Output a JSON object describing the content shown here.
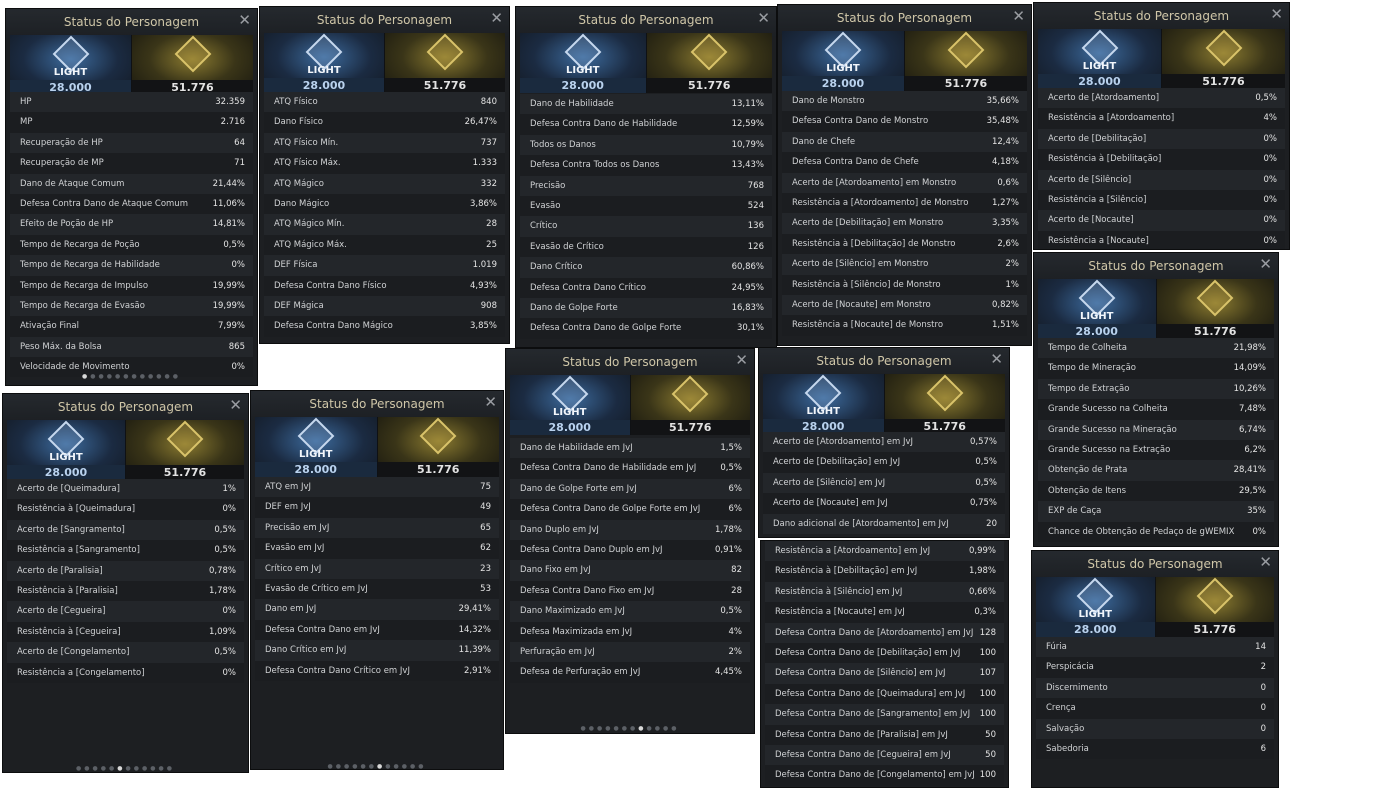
{
  "shared": {
    "panel_title": "Status do Personagem",
    "light_label": "LIGHT",
    "light_value": "28.000",
    "dark_value": "51.776"
  },
  "panels": [
    {
      "rows": [
        [
          "HP",
          "32.359"
        ],
        [
          "MP",
          "2.716"
        ],
        [
          "Recuperação de HP",
          "64"
        ],
        [
          "Recuperação de MP",
          "71"
        ],
        [
          "Dano de Ataque Comum",
          "21,44%"
        ],
        [
          "Defesa Contra Dano de Ataque Comum",
          "11,06%"
        ],
        [
          "Efeito de Poção de HP",
          "14,81%"
        ],
        [
          "Tempo de Recarga de Poção",
          "0,5%"
        ],
        [
          "Tempo de Recarga de Habilidade",
          "0%"
        ],
        [
          "Tempo de Recarga de Impulso",
          "19,99%"
        ],
        [
          "Tempo de Recarga de Evasão",
          "19,99%"
        ],
        [
          "Ativação Final",
          "7,99%"
        ],
        [
          "Peso Máx. da Bolsa",
          "865"
        ],
        [
          "Velocidade de Movimento",
          "0%"
        ]
      ]
    },
    {
      "rows": [
        [
          "ATQ Físico",
          "840"
        ],
        [
          "Dano Físico",
          "26,47%"
        ],
        [
          "ATQ Físico Mín.",
          "737"
        ],
        [
          "ATQ Físico Máx.",
          "1.333"
        ],
        [
          "ATQ Mágico",
          "332"
        ],
        [
          "Dano Mágico",
          "3,86%"
        ],
        [
          "ATQ Mágico Mín.",
          "28"
        ],
        [
          "ATQ Mágico Máx.",
          "25"
        ],
        [
          "DEF Física",
          "1.019"
        ],
        [
          "Defesa Contra Dano Físico",
          "4,93%"
        ],
        [
          "DEF Mágica",
          "908"
        ],
        [
          "Defesa Contra Dano Mágico",
          "3,85%"
        ]
      ]
    },
    {
      "rows": [
        [
          "Dano de Habilidade",
          "13,11%"
        ],
        [
          "Defesa Contra Dano de Habilidade",
          "12,59%"
        ],
        [
          "Todos os Danos",
          "10,79%"
        ],
        [
          "Defesa Contra Todos os Danos",
          "13,43%"
        ],
        [
          "Precisão",
          "768"
        ],
        [
          "Evasão",
          "524"
        ],
        [
          "Crítico",
          "136"
        ],
        [
          "Evasão de Crítico",
          "126"
        ],
        [
          "Dano Crítico",
          "60,86%"
        ],
        [
          "Defesa Contra Dano Crítico",
          "24,95%"
        ],
        [
          "Dano de Golpe Forte",
          "16,83%"
        ],
        [
          "Defesa Contra Dano de Golpe Forte",
          "30,1%"
        ]
      ]
    },
    {
      "rows": [
        [
          "Dano de Monstro",
          "35,66%"
        ],
        [
          "Defesa Contra Dano de Monstro",
          "35,48%"
        ],
        [
          "Dano de Chefe",
          "12,4%"
        ],
        [
          "Defesa Contra Dano de Chefe",
          "4,18%"
        ],
        [
          "Acerto de [Atordoamento] em Monstro",
          "0,6%"
        ],
        [
          "Resistência a [Atordoamento] de Monstro",
          "1,27%"
        ],
        [
          "Acerto de [Debilitação] em Monstro",
          "3,35%"
        ],
        [
          "Resistência à [Debilitação] de Monstro",
          "2,6%"
        ],
        [
          "Acerto de [Silêncio] em Monstro",
          "2%"
        ],
        [
          "Resistência à [Silêncio] de Monstro",
          "1%"
        ],
        [
          "Acerto de [Nocaute] em Monstro",
          "0,82%"
        ],
        [
          "Resistência a [Nocaute] de Monstro",
          "1,51%"
        ]
      ]
    },
    {
      "rows": [
        [
          "Acerto de [Atordoamento]",
          "0,5%"
        ],
        [
          "Resistência a [Atordoamento]",
          "4%"
        ],
        [
          "Acerto de [Debilitação]",
          "0%"
        ],
        [
          "Resistência à [Debilitação]",
          "0%"
        ],
        [
          "Acerto de [Silêncio]",
          "0%"
        ],
        [
          "Resistência a [Silêncio]",
          "0%"
        ],
        [
          "Acerto de [Nocaute]",
          "0%"
        ],
        [
          "Resistência a [Nocaute]",
          "0%"
        ]
      ]
    },
    {
      "rows": [
        [
          "Tempo de Colheita",
          "21,98%"
        ],
        [
          "Tempo de Mineração",
          "14,09%"
        ],
        [
          "Tempo de Extração",
          "10,26%"
        ],
        [
          "Grande Sucesso na Colheita",
          "7,48%"
        ],
        [
          "Grande Sucesso na Mineração",
          "6,74%"
        ],
        [
          "Grande Sucesso na Extração",
          "6,2%"
        ],
        [
          "Obtenção de Prata",
          "28,41%"
        ],
        [
          "Obtenção de Itens",
          "29,5%"
        ],
        [
          "EXP de Caça",
          "35%"
        ],
        [
          "Chance de Obtenção de Pedaço de gWEMIX",
          "0%"
        ]
      ]
    },
    {
      "rows": [
        [
          "Acerto de [Queimadura]",
          "1%"
        ],
        [
          "Resistência à [Queimadura]",
          "0%"
        ],
        [
          "Acerto de [Sangramento]",
          "0,5%"
        ],
        [
          "Resistência a [Sangramento]",
          "0,5%"
        ],
        [
          "Acerto de [Paralisia]",
          "0,78%"
        ],
        [
          "Resistência à [Paralisia]",
          "1,78%"
        ],
        [
          "Acerto de [Cegueira]",
          "0%"
        ],
        [
          "Resistência à [Cegueira]",
          "1,09%"
        ],
        [
          "Acerto de [Congelamento]",
          "0,5%"
        ],
        [
          "Resistência a [Congelamento]",
          "0%"
        ]
      ]
    },
    {
      "rows": [
        [
          "ATQ em JvJ",
          "75"
        ],
        [
          "DEF em JvJ",
          "49"
        ],
        [
          "Precisão em JvJ",
          "65"
        ],
        [
          "Evasão em JvJ",
          "62"
        ],
        [
          "Crítico em JvJ",
          "23"
        ],
        [
          "Evasão de Crítico em JvJ",
          "53"
        ],
        [
          "Dano em JvJ",
          "29,41%"
        ],
        [
          "Defesa Contra Dano em JvJ",
          "14,32%"
        ],
        [
          "Dano Crítico em JvJ",
          "11,39%"
        ],
        [
          "Defesa Contra Dano Crítico em JvJ",
          "2,91%"
        ]
      ]
    },
    {
      "rows": [
        [
          "Dano de Habilidade em JvJ",
          "1,5%"
        ],
        [
          "Defesa Contra Dano de Habilidade em JvJ",
          "0,5%"
        ],
        [
          "Dano de Golpe Forte em JvJ",
          "6%"
        ],
        [
          "Defesa Contra Dano de Golpe Forte em JvJ",
          "6%"
        ],
        [
          "Dano Duplo em JvJ",
          "1,78%"
        ],
        [
          "Defesa Contra Dano Duplo em JvJ",
          "0,91%"
        ],
        [
          "Dano Fixo em JvJ",
          "82"
        ],
        [
          "Defesa Contra Dano Fixo em JvJ",
          "28"
        ],
        [
          "Dano Maximizado em JvJ",
          "0,5%"
        ],
        [
          "Defesa Maximizada em JvJ",
          "4%"
        ],
        [
          "Perfuração em JvJ",
          "2%"
        ],
        [
          "Defesa de Perfuração em JvJ",
          "4,45%"
        ]
      ]
    },
    {
      "rows": [
        [
          "Acerto de [Atordoamento] em JvJ",
          "0,57%"
        ],
        [
          "Acerto de [Debilitação] em JvJ",
          "0,5%"
        ],
        [
          "Acerto de [Silêncio] em JvJ",
          "0,5%"
        ],
        [
          "Acerto de [Nocaute] em JvJ",
          "0,75%"
        ],
        [
          "Dano adicional de [Atordoamento] em JvJ",
          "20"
        ]
      ]
    },
    {
      "rows": [
        [
          "Resistência a [Atordoamento] em JvJ",
          "0,99%"
        ],
        [
          "Resistência à [Debilitação] em JvJ",
          "1,98%"
        ],
        [
          "Resistência à [Silêncio] em JvJ",
          "0,66%"
        ],
        [
          "Resistência a [Nocaute] em JvJ",
          "0,3%"
        ],
        [
          "Defesa Contra Dano de [Atordoamento] em JvJ",
          "128"
        ],
        [
          "Defesa Contra Dano de [Debilitação] em JvJ",
          "100"
        ],
        [
          "Defesa Contra Dano de [Silêncio] em JvJ",
          "107"
        ],
        [
          "Defesa Contra Dano de [Queimadura] em JvJ",
          "100"
        ],
        [
          "Defesa Contra Dano de [Sangramento] em JvJ",
          "100"
        ],
        [
          "Defesa Contra Dano de [Paralisia] em JvJ",
          "50"
        ],
        [
          "Defesa Contra Dano de [Cegueira] em JvJ",
          "50"
        ],
        [
          "Defesa Contra Dano de [Congelamento] em JvJ",
          "100"
        ]
      ]
    },
    {
      "rows": [
        [
          "Fúria",
          "14"
        ],
        [
          "Perspicácia",
          "2"
        ],
        [
          "Discernimento",
          "0"
        ],
        [
          "Crença",
          "0"
        ],
        [
          "Salvação",
          "0"
        ],
        [
          "Sabedoria",
          "6"
        ]
      ]
    }
  ]
}
